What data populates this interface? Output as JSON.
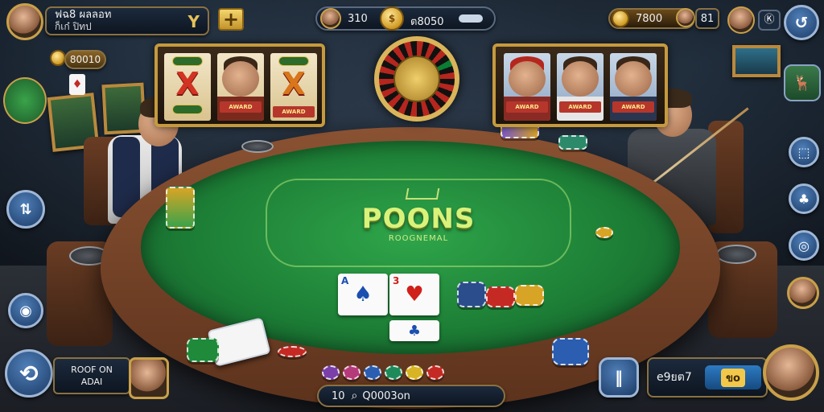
{
  "top_left": {
    "name_line1": "ฟฉ8 ผลลอท",
    "name_line2": "ก็เก๋ ปิทป",
    "rank_glyph": "Y",
    "add_label": "+"
  },
  "top_center": {
    "player_count": "310",
    "coins": "ต8050"
  },
  "top_right": {
    "coins": "7800",
    "counter": "81",
    "badge": "Ⓚ"
  },
  "left_panel": {
    "wallet": "80010"
  },
  "table": {
    "logo": "POONS",
    "subtitle": "ROOGNEMAL"
  },
  "cards": [
    {
      "rank": "A",
      "suit": "♠",
      "color": "#1b4fb0"
    },
    {
      "rank": "3",
      "suit": "♥",
      "color": "#d0201a"
    },
    {
      "rank": "",
      "suit": "♣",
      "color": "#1b4fb0"
    }
  ],
  "slot_left": {
    "symbols": [
      "X",
      "face",
      "X"
    ],
    "labels": [
      "",
      "AWARD",
      "AWARD"
    ]
  },
  "slot_right": {
    "labels": [
      "AWARD",
      "AWARD",
      "AWARD"
    ]
  },
  "bottom_left": {
    "line1": "ROOF ON",
    "line2": "ADAI"
  },
  "bottom_center": {
    "search_text": "Q0003on",
    "prefix": "10"
  },
  "bottom_right": {
    "score": "e9ยต7",
    "value": "ขo"
  },
  "side_right_icons": [
    "deer-icon",
    "dice-icon",
    "cards-icon",
    "owl-icon",
    "avatar-icon"
  ],
  "colors": {
    "felt": "#1d7f36",
    "gold": "#c59a3e",
    "hud_blue": "#1c3b66"
  }
}
